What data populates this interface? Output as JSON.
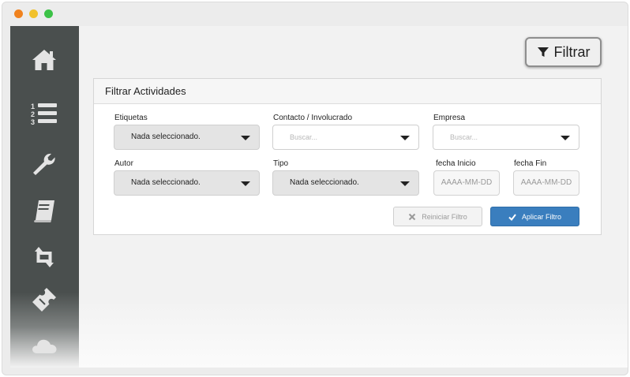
{
  "window": {
    "controls": [
      "close",
      "minimize",
      "zoom"
    ]
  },
  "sidebar": {
    "items": [
      {
        "icon": "home-icon"
      },
      {
        "icon": "numbered-list-icon"
      },
      {
        "icon": "wrench-icon"
      },
      {
        "icon": "book-icon"
      },
      {
        "icon": "retweet-icon"
      },
      {
        "icon": "ticket-icon"
      },
      {
        "icon": "cloud-icon"
      }
    ]
  },
  "toolbar": {
    "filter_label": "Filtrar",
    "filter_icon": "funnel-icon"
  },
  "filter_panel": {
    "title": "Filtrar Actividades",
    "etiquetas": {
      "label": "Etiquetas",
      "value": "Nada seleccionado."
    },
    "contacto": {
      "label": "Contacto / Involucrado",
      "placeholder": "Buscar..."
    },
    "empresa": {
      "label": "Empresa",
      "placeholder": "Buscar..."
    },
    "autor": {
      "label": "Autor",
      "value": "Nada seleccionado."
    },
    "tipo": {
      "label": "Tipo",
      "value": "Nada seleccionado."
    },
    "fecha_inicio": {
      "label": "fecha Inicio",
      "placeholder": "AAAA-MM-DD"
    },
    "fecha_fin": {
      "label": "fecha Fin",
      "placeholder": "AAAA-MM-DD"
    },
    "reset_label": "Reiniciar Filtro",
    "apply_label": "Aplicar Filtro"
  },
  "colors": {
    "sidebar": "#4a4f4e",
    "apply_button": "#3a7ebe",
    "background": "#f2f2f2"
  }
}
